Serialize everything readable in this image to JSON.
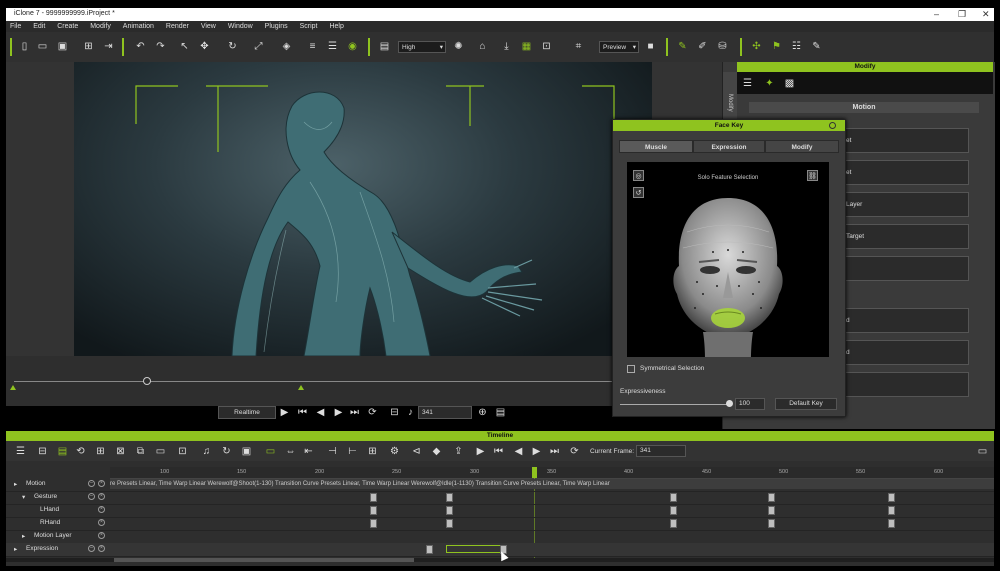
{
  "window": {
    "title": "iClone 7 - 9999999999.iProject *",
    "controls": [
      "–",
      "❐",
      "✕"
    ]
  },
  "menu": [
    "File",
    "Edit",
    "Create",
    "Modify",
    "Animation",
    "Render",
    "View",
    "Window",
    "Plugins",
    "Script",
    "Help"
  ],
  "toolbar": {
    "quality_value": "High",
    "preview_value": "Preview"
  },
  "playback": {
    "realtime_label": "Realtime",
    "frame_value": "341"
  },
  "modify_panel": {
    "title": "Modify",
    "side_tab": "Modify",
    "section_title": "Motion",
    "button_labels": [
      "et",
      "et",
      "Layer",
      "Target",
      "",
      "d",
      "d",
      ""
    ]
  },
  "face_key": {
    "title": "Face Key",
    "tabs": [
      "Muscle",
      "Expression",
      "Modify"
    ],
    "view_label": "Solo Feature Selection",
    "symmetrical_label": "Symmetrical Selection",
    "symmetrical_checked": false,
    "expressiveness_label": "Expressiveness",
    "expressiveness_value": "100",
    "expressiveness_level": 1.0,
    "default_key_label": "Default Key"
  },
  "timeline": {
    "title": "Timeline",
    "current_frame_label": "Current Frame:",
    "current_frame_value": "341",
    "ruler_ticks": [
      "100",
      "150",
      "200",
      "250",
      "300",
      "350",
      "400",
      "450",
      "500",
      "550",
      "600"
    ],
    "tracks": [
      {
        "label": "Motion",
        "level": 0,
        "clip_text": "re Presets   Linear, Time Warp   Linear                                                   Werewolf@Shoot(1-130) Transition Curve Presets   Linear, Time Warp   Linear                                                        Werewolf@Idle(1-1130) Transition Curve Presets   Linear, Time Warp   Linear"
      },
      {
        "label": "Gesture",
        "level": 1
      },
      {
        "label": "LHand",
        "level": 2
      },
      {
        "label": "RHand",
        "level": 2
      },
      {
        "label": "Motion Layer",
        "level": 1
      },
      {
        "label": "Expression",
        "level": 0
      }
    ]
  },
  "colors": {
    "accent": "#8fc31f",
    "panel": "#3a3a3a",
    "dark": "#1a1a1a"
  }
}
